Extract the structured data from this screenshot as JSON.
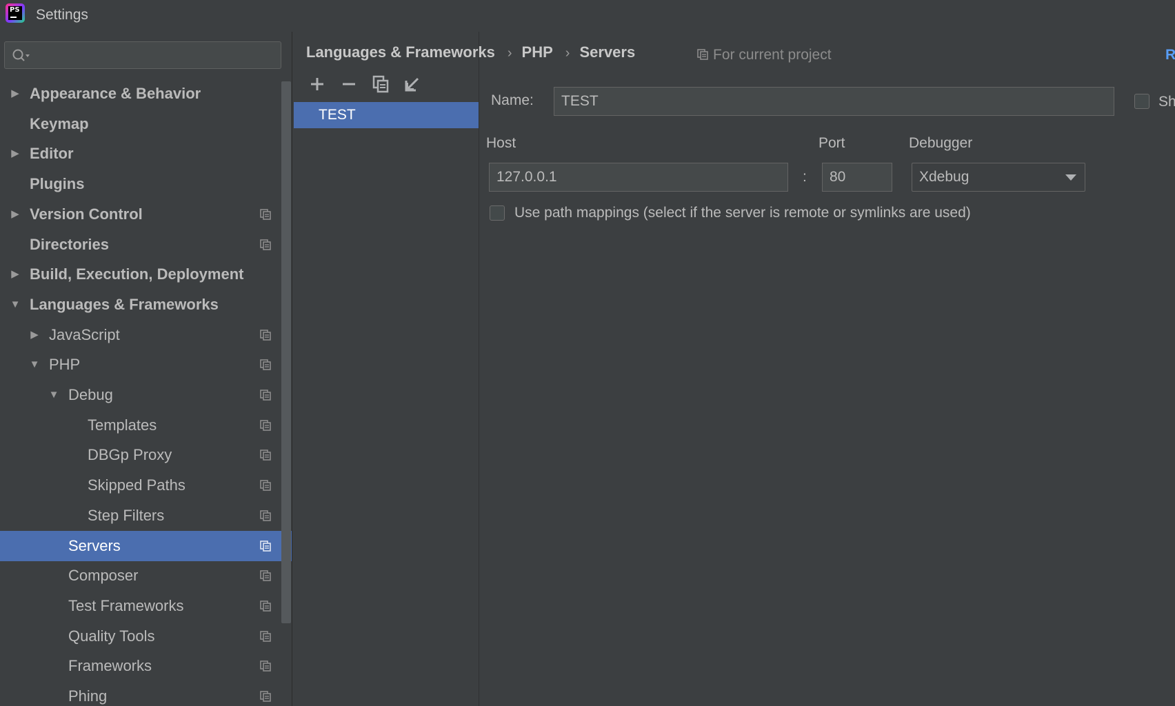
{
  "window": {
    "title": "Settings",
    "app_icon": "phpstorm-logo-icon",
    "app_icon_text": "PS"
  },
  "search": {
    "value": "",
    "placeholder": ""
  },
  "tree": [
    {
      "label": "Appearance & Behavior",
      "expander": "collapsed",
      "bold": true,
      "project": false,
      "selected": false
    },
    {
      "label": "Keymap",
      "expander": "none",
      "bold": true,
      "project": false,
      "selected": false
    },
    {
      "label": "Editor",
      "expander": "collapsed",
      "bold": true,
      "project": false,
      "selected": false
    },
    {
      "label": "Plugins",
      "expander": "none",
      "bold": true,
      "project": false,
      "selected": false
    },
    {
      "label": "Version Control",
      "expander": "collapsed",
      "bold": true,
      "project": true,
      "selected": false
    },
    {
      "label": "Directories",
      "expander": "none",
      "bold": true,
      "project": true,
      "selected": false
    },
    {
      "label": "Build, Execution, Deployment",
      "expander": "collapsed",
      "bold": true,
      "project": false,
      "selected": false
    },
    {
      "label": "Languages & Frameworks",
      "expander": "expanded",
      "bold": true,
      "project": false,
      "selected": false
    },
    {
      "label": "JavaScript",
      "expander": "collapsed",
      "bold": false,
      "project": true,
      "selected": false
    },
    {
      "label": "PHP",
      "expander": "expanded",
      "bold": false,
      "project": true,
      "selected": false
    },
    {
      "label": "Debug",
      "expander": "expanded",
      "bold": false,
      "project": true,
      "selected": false
    },
    {
      "label": "Templates",
      "expander": "none",
      "bold": false,
      "project": true,
      "selected": false
    },
    {
      "label": "DBGp Proxy",
      "expander": "none",
      "bold": false,
      "project": true,
      "selected": false
    },
    {
      "label": "Skipped Paths",
      "expander": "none",
      "bold": false,
      "project": true,
      "selected": false
    },
    {
      "label": "Step Filters",
      "expander": "none",
      "bold": false,
      "project": true,
      "selected": false
    },
    {
      "label": "Servers",
      "expander": "none",
      "bold": false,
      "project": true,
      "selected": true
    },
    {
      "label": "Composer",
      "expander": "none",
      "bold": false,
      "project": true,
      "selected": false
    },
    {
      "label": "Test Frameworks",
      "expander": "none",
      "bold": false,
      "project": true,
      "selected": false
    },
    {
      "label": "Quality Tools",
      "expander": "none",
      "bold": false,
      "project": true,
      "selected": false
    },
    {
      "label": "Frameworks",
      "expander": "none",
      "bold": false,
      "project": true,
      "selected": false
    },
    {
      "label": "Phing",
      "expander": "none",
      "bold": false,
      "project": true,
      "selected": false
    }
  ],
  "breadcrumb": {
    "items": [
      "Languages & Frameworks",
      "PHP",
      "Servers"
    ],
    "separator": "›",
    "for_project": "For current project",
    "reset": "R"
  },
  "toolbar": {
    "buttons": [
      "add-icon",
      "remove-icon",
      "copy-icon",
      "import-icon"
    ]
  },
  "servers": {
    "items": [
      {
        "name": "TEST",
        "selected": true
      }
    ]
  },
  "form": {
    "name_label": "Name:",
    "name_value": "TEST",
    "shared_label": "Sh",
    "host_label": "Host",
    "host_value": "127.0.0.1",
    "port_label": "Port",
    "port_separator": ":",
    "port_value": "80",
    "debugger_label": "Debugger",
    "debugger_value": "Xdebug",
    "path_mappings_label": "Use path mappings (select if the server is remote or symlinks are used)",
    "path_mappings_checked": false
  },
  "colors": {
    "background": "#3c3f41",
    "selection": "#4b6eaf",
    "field_bg": "#45494a",
    "text": "#bbbbbb",
    "link": "#589df6"
  }
}
